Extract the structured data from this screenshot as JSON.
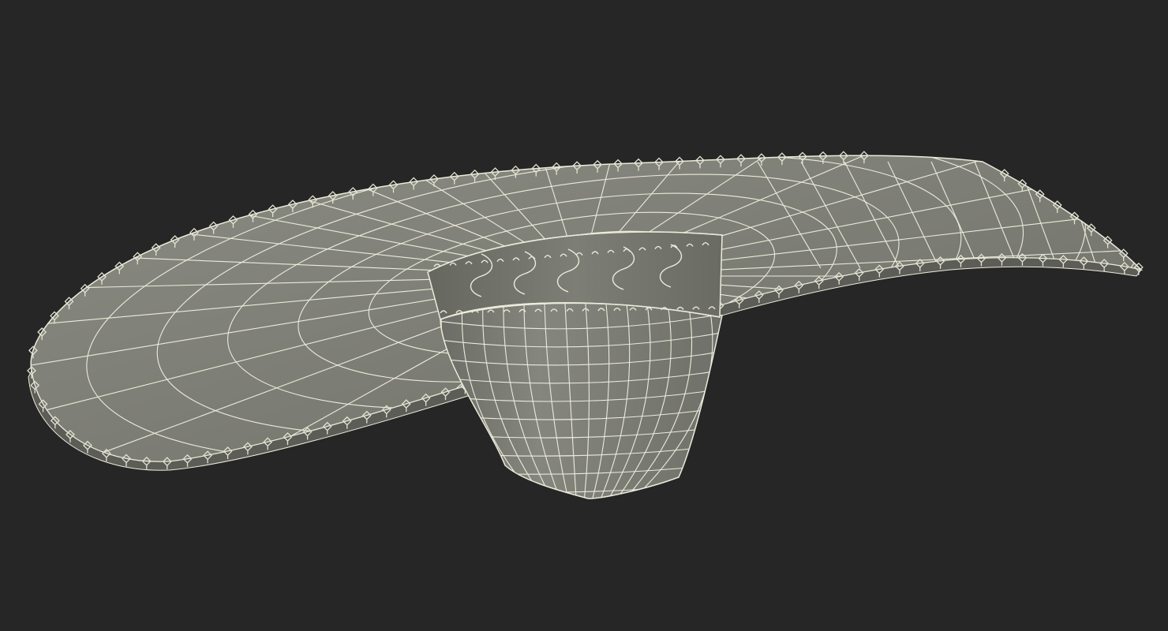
{
  "scene": {
    "subject": "sombrero-wireframe-model",
    "colors": {
      "background": "#262626",
      "surface": "#7a7b72",
      "surface_light": "#8c8d84",
      "surface_dark": "#5f605a",
      "wire": "#ecebdc",
      "trim": "#d9d8c8"
    }
  }
}
